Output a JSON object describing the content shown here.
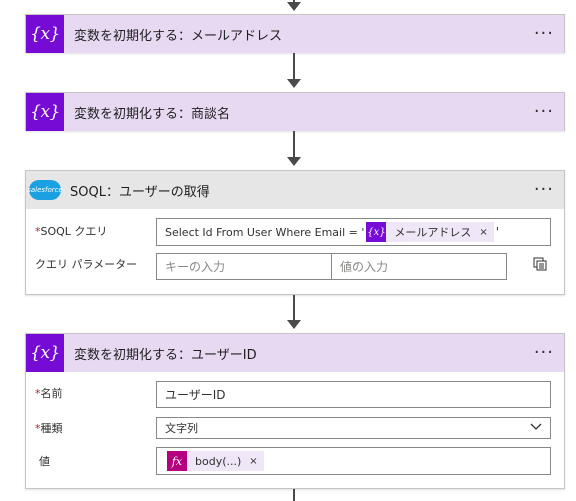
{
  "connector_arrow": "arrow-down-icon",
  "cards": {
    "email": {
      "title": "変数を初期化する：メールアドレス",
      "icon": "{x}",
      "more": "···"
    },
    "deal": {
      "title": "変数を初期化する：商談名",
      "icon": "{x}",
      "more": "···"
    },
    "soql": {
      "title": "SOQL：ユーザーの取得",
      "logo_text": "salesforce",
      "more": "···",
      "query_label": "SOQL クエリ",
      "query_prefix": "Select Id From User Where Email = '",
      "query_token": "メールアドレス",
      "query_suffix": "'",
      "params_label": "クエリ パラメーター",
      "key_placeholder": "キーの入力",
      "value_placeholder": "値の入力"
    },
    "userid": {
      "title": "変数を初期化する：ユーザーID",
      "icon": "{x}",
      "more": "···",
      "name_label": "名前",
      "name_value": "ユーザーID",
      "type_label": "種類",
      "type_value": "文字列",
      "value_label": "値",
      "value_token_icon": "fx",
      "value_token": "body(...)"
    }
  },
  "required_mark": "*",
  "remove_mark": "×",
  "colors": {
    "variable_accent": "#770bd6",
    "variable_header": "#e8d9f3",
    "expression_accent": "#b4007e",
    "salesforce_blue": "#1ba1e2"
  }
}
